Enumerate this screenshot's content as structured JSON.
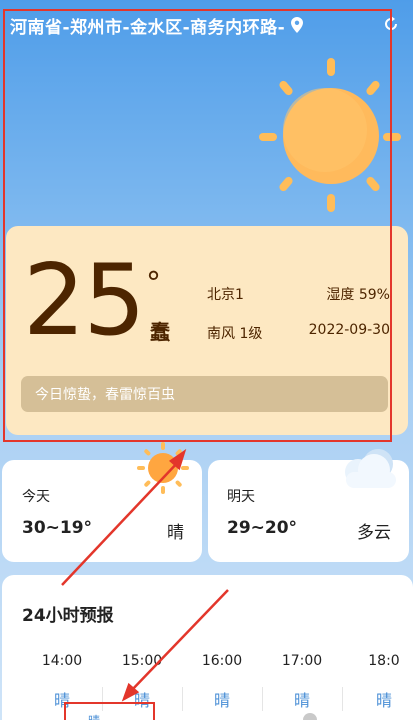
{
  "header": {
    "location": "河南省-郑州市-金水区-商务内环路-",
    "pin_icon": "location-pin-icon",
    "refresh_icon": "refresh-icon"
  },
  "current": {
    "temperature": "25",
    "degree": "°",
    "season_glyph": "蠢",
    "city": "北京1",
    "humidity": "湿度 59%",
    "wind": "南风 1级",
    "date": "2022-09-30",
    "tip": "今日惊蛰，春雷惊百虫"
  },
  "days": [
    {
      "name": "今天",
      "temp": "30~19°",
      "condition": "晴",
      "icon": "sun-icon"
    },
    {
      "name": "明天",
      "temp": "29~20°",
      "condition": "多云",
      "icon": "cloud-icon"
    }
  ],
  "hourly": {
    "title": "24小时预报",
    "items": [
      {
        "time": "14:00",
        "condition": "晴"
      },
      {
        "time": "15:00",
        "condition": "晴"
      },
      {
        "time": "16:00",
        "condition": "晴"
      },
      {
        "time": "17:00",
        "condition": "晴"
      },
      {
        "time": "18:0",
        "condition": "晴"
      }
    ]
  },
  "bottom_tab": {
    "label": "晴"
  },
  "colors": {
    "card_bg": "#fde8c2",
    "temp_text": "#4d2500",
    "annotation": "#e3362b",
    "sun": "#ffb74d"
  }
}
